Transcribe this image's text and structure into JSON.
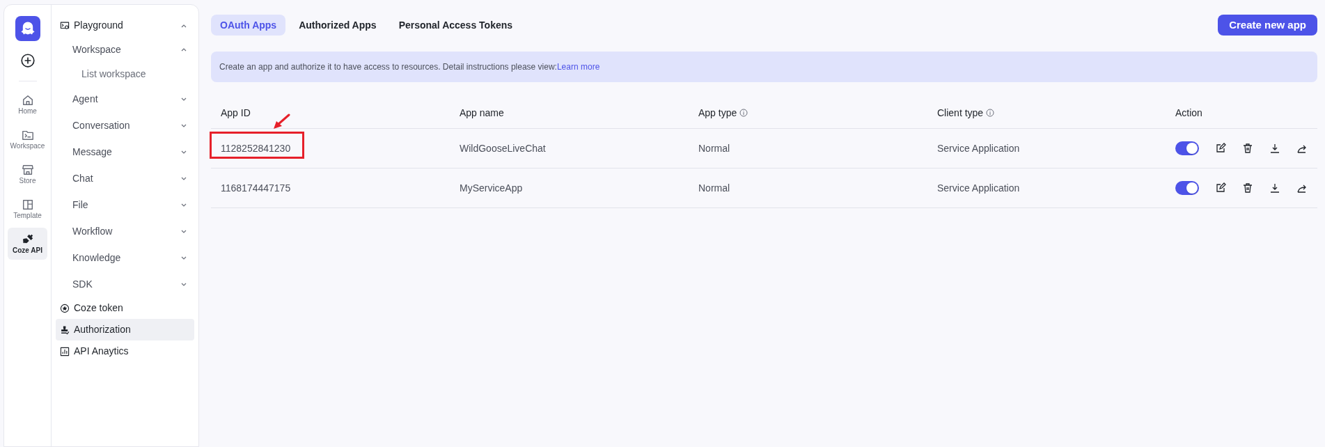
{
  "rail": {
    "items": [
      {
        "label": "Home",
        "kind": "home",
        "selected": false
      },
      {
        "label": "Workspace",
        "kind": "terminal",
        "selected": false
      },
      {
        "label": "Store",
        "kind": "store",
        "selected": false
      },
      {
        "label": "Template",
        "kind": "template",
        "selected": false
      },
      {
        "label": "Coze API",
        "kind": "plug",
        "selected": true
      }
    ]
  },
  "sidebar": {
    "items": [
      {
        "label": "Playground",
        "kind": "playground",
        "expanded": true,
        "selected": false,
        "children": [
          {
            "label": "Workspace",
            "expanded": true,
            "children": [
              {
                "label": "List workspace"
              }
            ]
          },
          {
            "label": "Agent",
            "expanded": false
          },
          {
            "label": "Conversation",
            "expanded": false
          },
          {
            "label": "Message",
            "expanded": false
          },
          {
            "label": "Chat",
            "expanded": false
          },
          {
            "label": "File",
            "expanded": false
          },
          {
            "label": "Workflow",
            "expanded": false
          },
          {
            "label": "Knowledge",
            "expanded": false
          },
          {
            "label": "SDK",
            "expanded": false
          }
        ]
      },
      {
        "label": "Coze token",
        "kind": "token",
        "selected": false
      },
      {
        "label": "Authorization",
        "kind": "stamp",
        "selected": true
      },
      {
        "label": "API Anaytics",
        "kind": "chart",
        "selected": false
      }
    ]
  },
  "tabs": [
    {
      "label": "OAuth Apps",
      "selected": true
    },
    {
      "label": "Authorized Apps",
      "selected": false
    },
    {
      "label": "Personal Access Tokens",
      "selected": false
    }
  ],
  "create_button": "Create new app",
  "banner": {
    "text": "Create an app and authorize it to have access to resources. Detail instructions please view:",
    "link": "Learn more"
  },
  "table": {
    "columns": [
      {
        "label": "App ID",
        "info": false
      },
      {
        "label": "App name",
        "info": false
      },
      {
        "label": "App type",
        "info": true
      },
      {
        "label": "Client type",
        "info": true
      },
      {
        "label": "Action",
        "info": false
      }
    ],
    "rows": [
      {
        "app_id": "1128252841230",
        "app_name": "WildGooseLiveChat",
        "app_type": "Normal",
        "client_type": "Service Application",
        "enabled": true,
        "highlighted": true
      },
      {
        "app_id": "1168174447175",
        "app_name": "MyServiceApp",
        "app_type": "Normal",
        "client_type": "Service Application",
        "enabled": true,
        "highlighted": false
      }
    ]
  }
}
